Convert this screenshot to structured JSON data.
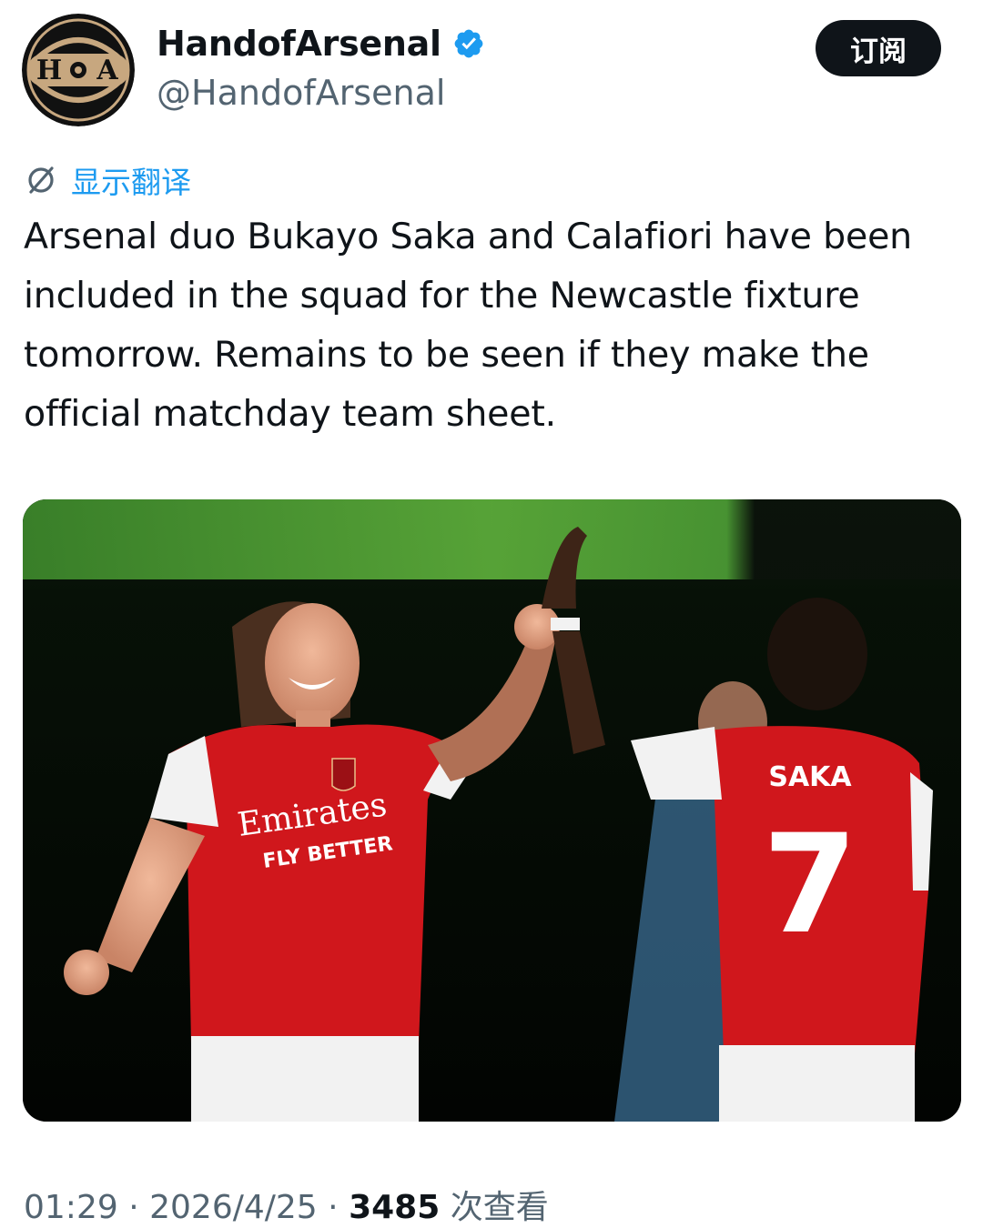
{
  "tweet": {
    "author": {
      "display_name": "HandofArsenal",
      "handle": "@HandofArsenal",
      "verified": true,
      "avatar_letters": "H•A"
    },
    "subscribe_label": "订阅",
    "translate_label": "显示翻译",
    "text": "Arsenal duo Bukayo Saka and Calafiori have been included in the squad for the Newcastle fixture tomorrow. Remains to be seen if they make the official matchday team sheet.",
    "media": {
      "jersey_sponsor": "Emirates",
      "jersey_sponsor_tagline": "FLY BETTER",
      "back_name": "SAKA",
      "back_number": "7"
    },
    "meta": {
      "time": "01:29",
      "separator": "·",
      "date": "2026/4/25",
      "views": "3485",
      "views_label": "次查看"
    }
  },
  "colors": {
    "accent": "#1d9bf0",
    "text_primary": "#0f1419",
    "text_secondary": "#536471",
    "arsenal_red": "#d0171c"
  }
}
